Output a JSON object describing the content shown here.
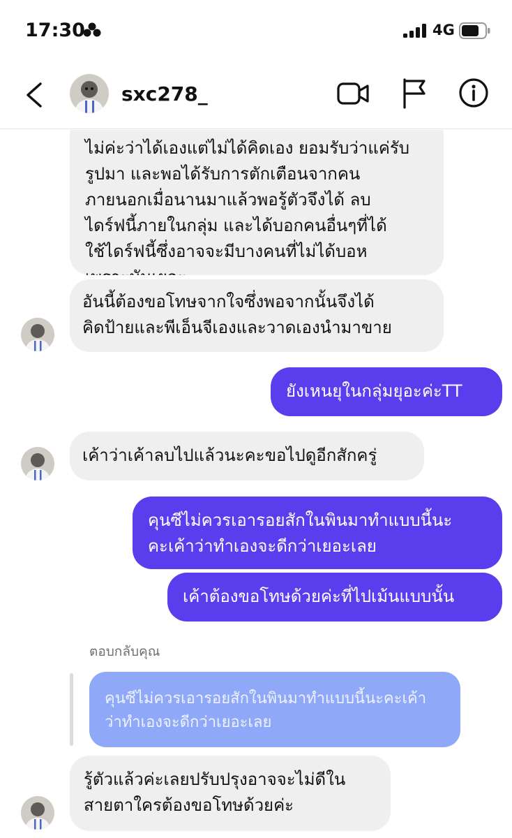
{
  "status_bar": {
    "time": "17:30",
    "network": "4G"
  },
  "header": {
    "username": "sxc278_"
  },
  "messages": [
    {
      "text": "ไม่ค่ะว่าได้เองแต่ไม่ได้คิดเอง ยอมรับว่าแค่รับ\nรูปมา และพอได้รับการตักเตือนจากคน\nภายนอกเมื่อนานมาแล้วพอรู้ตัวจึงได้ ลบ\nไดร์ฟนี้ภายในกลุ่ม และได้บอกคนอื่นๆที่ได้\nใช้ไดร์ฟนี้ซึ่งอาจจะมีบางคนที่ไม่ได้บอห\nเพราะมันเยอะ"
    },
    {
      "text": "อันนี้ต้องขอโทษจากใจซึ่งพอจากนั้นจึงได้\nคิดป้ายและพีเอ็นจีเองและวาดเองนำมาขาย"
    },
    {
      "text": "ยังเหนยุในกลุ่มยุอะค่ะTT"
    },
    {
      "text": "เค้าว่าเค้าลบไปแล้วนะคะขอไปดูอีกสักครู่"
    },
    {
      "text": "คุนซีไม่ควรเอารอยสักในพินมาทำแบบนี้นะ\nคะเค้าว่าทำเองจะดีกว่าเยอะเลย"
    },
    {
      "text": "เค้าต้องขอโทษด้วยค่ะที่ไปเม้นแบบนั้น"
    },
    {
      "text": "รู้ตัวแล้วค่ะเลยปรับปรุงอาจจะไม่ดีใน\nสายตาใครต้องขอโทษด้วยค่ะ"
    }
  ],
  "reply": {
    "label": "ตอบกลับคุณ",
    "quoted_text": "คุนซีไม่ควรเอารอยสักในพินมาทำแบบนี้นะคะเค้า\nว่าทำเองจะดีกว่าเยอะเลย"
  },
  "colors": {
    "outgoing": "#5a3ded",
    "incoming": "#efefef",
    "reply_quote": "#8fa8f8"
  },
  "icons": [
    "focus-icon",
    "signal-icon",
    "battery-icon",
    "back-icon",
    "video-call-icon",
    "flag-icon",
    "info-icon"
  ]
}
